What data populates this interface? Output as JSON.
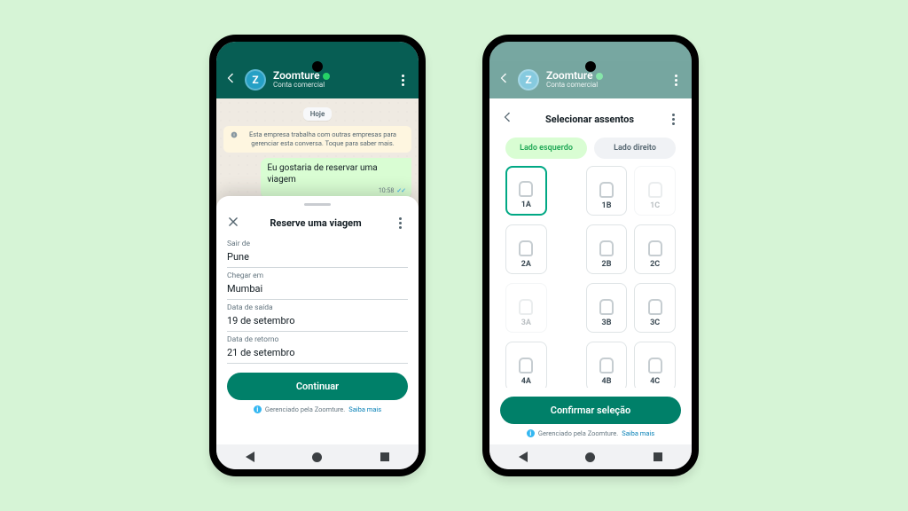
{
  "business": {
    "name": "Zoomture",
    "subtitle": "Conta comercial",
    "avatar_letter": "Z"
  },
  "chat": {
    "date_label": "Hoje",
    "system_notice": "Esta empresa trabalha com outras empresas para gerenciar esta conversa. Toque para saber mais.",
    "outgoing_message": "Eu gostaria de reservar uma viagem",
    "outgoing_time": "10:58"
  },
  "booking_sheet": {
    "title": "Reserve uma viagem",
    "fields": {
      "from_label": "Sair de",
      "from_value": "Pune",
      "to_label": "Chegar em",
      "to_value": "Mumbai",
      "depart_label": "Data de saída",
      "depart_value": "19 de setembro",
      "return_label": "Data de retorno",
      "return_value": "21 de setembro"
    },
    "cta": "Continuar",
    "managed_prefix": "Gerenciado pela Zoomture.",
    "learn_more": "Saiba mais"
  },
  "seat_sheet": {
    "title": "Selecionar assentos",
    "tab_left": "Lado esquerdo",
    "tab_right": "Lado direito",
    "rows": [
      {
        "left": {
          "label": "1A",
          "state": "selected"
        },
        "midL": {
          "label": "1B",
          "state": "normal"
        },
        "midR": {
          "label": "1C",
          "state": "disabled"
        }
      },
      {
        "left": {
          "label": "2A",
          "state": "normal"
        },
        "midL": {
          "label": "2B",
          "state": "normal"
        },
        "midR": {
          "label": "2C",
          "state": "normal"
        }
      },
      {
        "left": {
          "label": "3A",
          "state": "disabled"
        },
        "midL": {
          "label": "3B",
          "state": "normal"
        },
        "midR": {
          "label": "3C",
          "state": "normal"
        }
      },
      {
        "left": {
          "label": "4A",
          "state": "normal"
        },
        "midL": {
          "label": "4B",
          "state": "normal"
        },
        "midR": {
          "label": "4C",
          "state": "normal"
        }
      }
    ],
    "cta": "Confirmar seleção",
    "managed_prefix": "Gerenciado pela Zoomture.",
    "learn_more": "Saiba mais"
  }
}
